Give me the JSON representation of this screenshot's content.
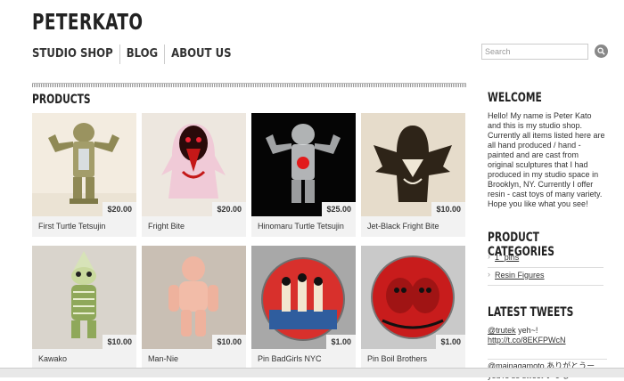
{
  "site": {
    "title": "PETERKATO"
  },
  "nav": {
    "items": [
      "STUDIO SHOP",
      "BLOG",
      "ABOUT US"
    ]
  },
  "search": {
    "placeholder": "Search"
  },
  "products": {
    "title": "PRODUCTS",
    "items": [
      {
        "name": "First Turtle Tetsujin",
        "price": "$20.00",
        "bg": "#f3ece0"
      },
      {
        "name": "Fright Bite",
        "price": "$20.00",
        "bg": "#ede7df"
      },
      {
        "name": "Hinomaru Turtle Tetsujin",
        "price": "$25.00",
        "bg": "#050505"
      },
      {
        "name": "Jet-Black Fright Bite",
        "price": "$10.00",
        "bg": "#e6dccb"
      },
      {
        "name": "Kawako",
        "price": "$10.00",
        "bg": "#d9d4cc"
      },
      {
        "name": "Man-Nie",
        "price": "$10.00",
        "bg": "#c9bfb4"
      },
      {
        "name": "Pin BadGirls NYC",
        "price": "$1.00",
        "bg": "#a8a8a8"
      },
      {
        "name": "Pin Boil Brothers",
        "price": "$1.00",
        "bg": "#c9c9c9"
      }
    ]
  },
  "sidebar": {
    "welcome_title": "WELCOME",
    "welcome_text": "Hello! My name is Peter Kato and this is my studio shop. Currently all items listed here are all hand produced / hand - painted and are cast from original sculptures that I had produced in my studio space in Brooklyn, NY. Currently I offer resin - cast toys of many variety. Hope you like what you see!",
    "categories_title": "PRODUCT CATEGORIES",
    "categories": [
      "1\" pins",
      "Resin Figures"
    ],
    "tweets_title": "LATEST TWEETS",
    "tweets": [
      {
        "user": "@trutek",
        "text": " yeh~!",
        "link": "http://t.co/8EKFPWcN"
      },
      {
        "user": "@mainagamoto",
        "text": " ありがとうー you're so sweet いつも"
      }
    ]
  },
  "colors": {
    "accent": "#222222",
    "price_bg": "#f2f2f2",
    "search_button": "#888888"
  }
}
